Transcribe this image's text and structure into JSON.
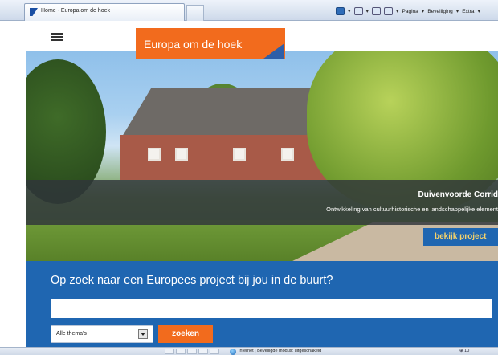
{
  "browser": {
    "tab_title": "Home - Europa om de hoek",
    "menu": [
      "Pagina",
      "Beveiliging",
      "Extra"
    ],
    "status_zone": "Internet | Beveiligde modus: uitgeschakeld",
    "zoom": "⊕ 10"
  },
  "header": {
    "brand": "Europa om de hoek"
  },
  "hero": {
    "title": "Duivenvoorde Corrid",
    "subtitle": "Ontwikkeling van cultuurhistorische en landschappelijke element",
    "cta": "bekijk project"
  },
  "search": {
    "heading": "Op zoek naar een Europees project bij jou in de buurt?",
    "placeholder": "",
    "theme_select": "Alle thema's",
    "button": "zoeken"
  },
  "colors": {
    "brand_orange": "#f26b1d",
    "panel_blue": "#1f66b1",
    "cta_text": "#f7d36a"
  }
}
